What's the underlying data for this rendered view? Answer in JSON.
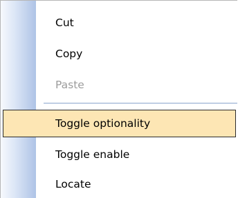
{
  "context_menu": {
    "items": [
      {
        "label": "Cut",
        "state": "enabled"
      },
      {
        "label": "Copy",
        "state": "enabled"
      },
      {
        "label": "Paste",
        "state": "disabled"
      },
      {
        "label": "Toggle optionality",
        "state": "highlighted"
      },
      {
        "label": "Toggle enable",
        "state": "enabled"
      },
      {
        "label": "Locate",
        "state": "enabled"
      }
    ]
  }
}
